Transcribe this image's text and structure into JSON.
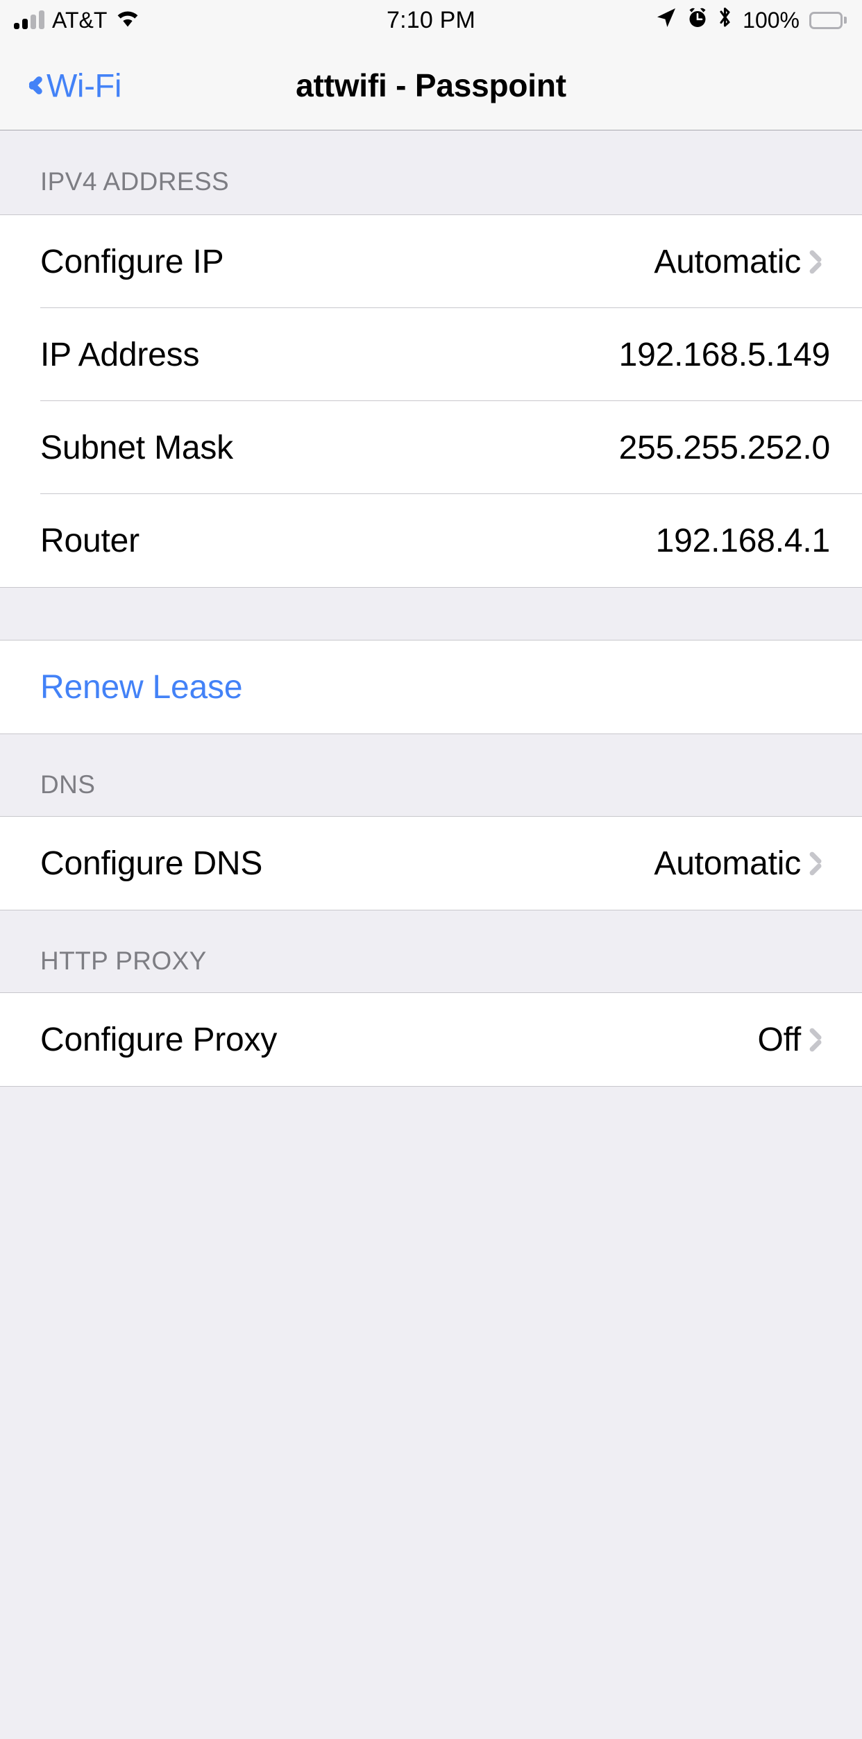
{
  "status_bar": {
    "carrier": "AT&T",
    "signal_bars_filled": 2,
    "signal_bars_total": 4,
    "wifi_icon": "wifi-icon",
    "time": "7:10 PM",
    "location_icon": "location-arrow-icon",
    "alarm_icon": "alarm-clock-icon",
    "bluetooth_icon": "bluetooth-icon",
    "battery_percent": "100%",
    "battery_level": 100
  },
  "nav_bar": {
    "back_label": "Wi-Fi",
    "back_icon": "chevron-left-icon",
    "title": "attwifi - Passpoint"
  },
  "colors": {
    "accent_blue": "#4382F7",
    "group_background": "#FFFFFF",
    "page_background": "#EFEEF3",
    "separator": "#C8C7CC",
    "header_text": "#7D7D83",
    "chevron": "#C6C6CB"
  },
  "sections": [
    {
      "header": "IPV4 ADDRESS",
      "rows": [
        {
          "label": "Configure IP",
          "value": "Automatic",
          "chevron": true
        },
        {
          "label": "IP Address",
          "value": "192.168.5.149",
          "chevron": false
        },
        {
          "label": "Subnet Mask",
          "value": "255.255.252.0",
          "chevron": false
        },
        {
          "label": "Router",
          "value": "192.168.4.1",
          "chevron": false
        }
      ]
    },
    {
      "header": "",
      "rows": [
        {
          "label": "Renew Lease",
          "value": "",
          "chevron": false,
          "style": "link"
        }
      ]
    },
    {
      "header": "DNS",
      "rows": [
        {
          "label": "Configure DNS",
          "value": "Automatic",
          "chevron": true
        }
      ]
    },
    {
      "header": "HTTP PROXY",
      "rows": [
        {
          "label": "Configure Proxy",
          "value": "Off",
          "chevron": true
        }
      ]
    }
  ]
}
